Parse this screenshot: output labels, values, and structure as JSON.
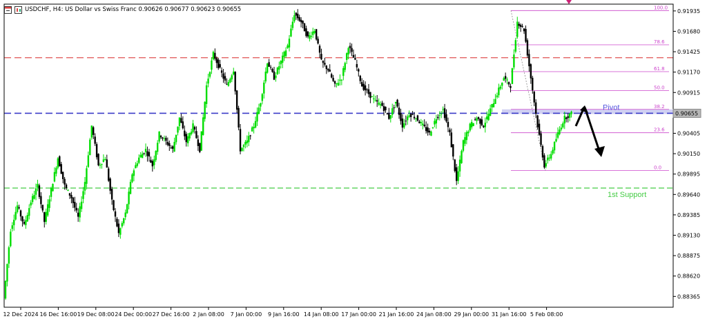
{
  "header": {
    "symbol_line": "USDCHF, H4:  US Dollar vs Swiss Franc  0.90626 0.90677 0.90623 0.90655",
    "chart_icon": "chart-window-icon",
    "indicator_icon": "candles-icon"
  },
  "chart_data": {
    "type": "candlestick",
    "symbol": "USDCHF",
    "timeframe": "H4",
    "ylim": [
      0.8823,
      0.9202
    ],
    "y_ticks": [
      "0.91935",
      "0.91680",
      "0.91425",
      "0.91170",
      "0.90915",
      "0.90655",
      "0.90405",
      "0.90150",
      "0.89895",
      "0.89640",
      "0.89385",
      "0.89130",
      "0.88875",
      "0.88620",
      "0.88365"
    ],
    "x_ticks": [
      "12 Dec 2024",
      "16 Dec 16:00",
      "19 Dec 08:00",
      "24 Dec 00:00",
      "27 Dec 16:00",
      "2 Jan 08:00",
      "7 Jan 00:00",
      "9 Jan 16:00",
      "14 Jan 08:00",
      "17 Jan 00:00",
      "21 Jan 16:00",
      "24 Jan 08:00",
      "29 Jan 00:00",
      "31 Jan 16:00",
      "5 Feb 08:00"
    ],
    "current_price": "0.90655",
    "horizontal_lines": [
      {
        "price": 0.9135,
        "style": "dashed",
        "color": "#e05050"
      },
      {
        "price": 0.90655,
        "style": "dashed",
        "color": "#3a3ac8"
      },
      {
        "price": 0.8972,
        "style": "dashed",
        "color": "#44cc44"
      }
    ],
    "fibonacci": {
      "high": 0.9194,
      "low": 0.8994,
      "levels": [
        {
          "label": "100.0",
          "value": 0.9194
        },
        {
          "label": "78.6",
          "value": 0.91512
        },
        {
          "label": "61.8",
          "value": 0.91176
        },
        {
          "label": "50.0",
          "value": 0.9094
        },
        {
          "label": "38.2",
          "value": 0.90704
        },
        {
          "label": "23.6",
          "value": 0.90412
        },
        {
          "label": "0.0",
          "value": 0.8994
        }
      ]
    },
    "annotations": {
      "pivot": "Pivot",
      "support": "1st Support"
    },
    "colors": {
      "bull": "#00dd00",
      "bear": "#000000",
      "fib": "#cc44cc",
      "pivot_zone": "#c8c8f0"
    },
    "candle_path": [
      0.8834,
      0.892,
      0.895,
      0.8925,
      0.8955,
      0.8975,
      0.893,
      0.897,
      0.901,
      0.8975,
      0.896,
      0.8935,
      0.898,
      0.905,
      0.9,
      0.901,
      0.8955,
      0.8915,
      0.894,
      0.899,
      0.901,
      0.902,
      0.9,
      0.904,
      0.903,
      0.902,
      0.906,
      0.903,
      0.905,
      0.902,
      0.91,
      0.914,
      0.912,
      0.91,
      0.912,
      0.902,
      0.903,
      0.905,
      0.908,
      0.913,
      0.911,
      0.913,
      0.915,
      0.919,
      0.918,
      0.916,
      0.917,
      0.913,
      0.912,
      0.91,
      0.911,
      0.915,
      0.913,
      0.91,
      0.909,
      0.908,
      0.9075,
      0.906,
      0.908,
      0.905,
      0.9065,
      0.906,
      0.905,
      0.904,
      0.906,
      0.907,
      0.904,
      0.898,
      0.903,
      0.905,
      0.906,
      0.905,
      0.907,
      0.909,
      0.911,
      0.91,
      0.918,
      0.917,
      0.911,
      0.905,
      0.9,
      0.9015,
      0.904,
      0.906,
      0.9065
    ]
  }
}
